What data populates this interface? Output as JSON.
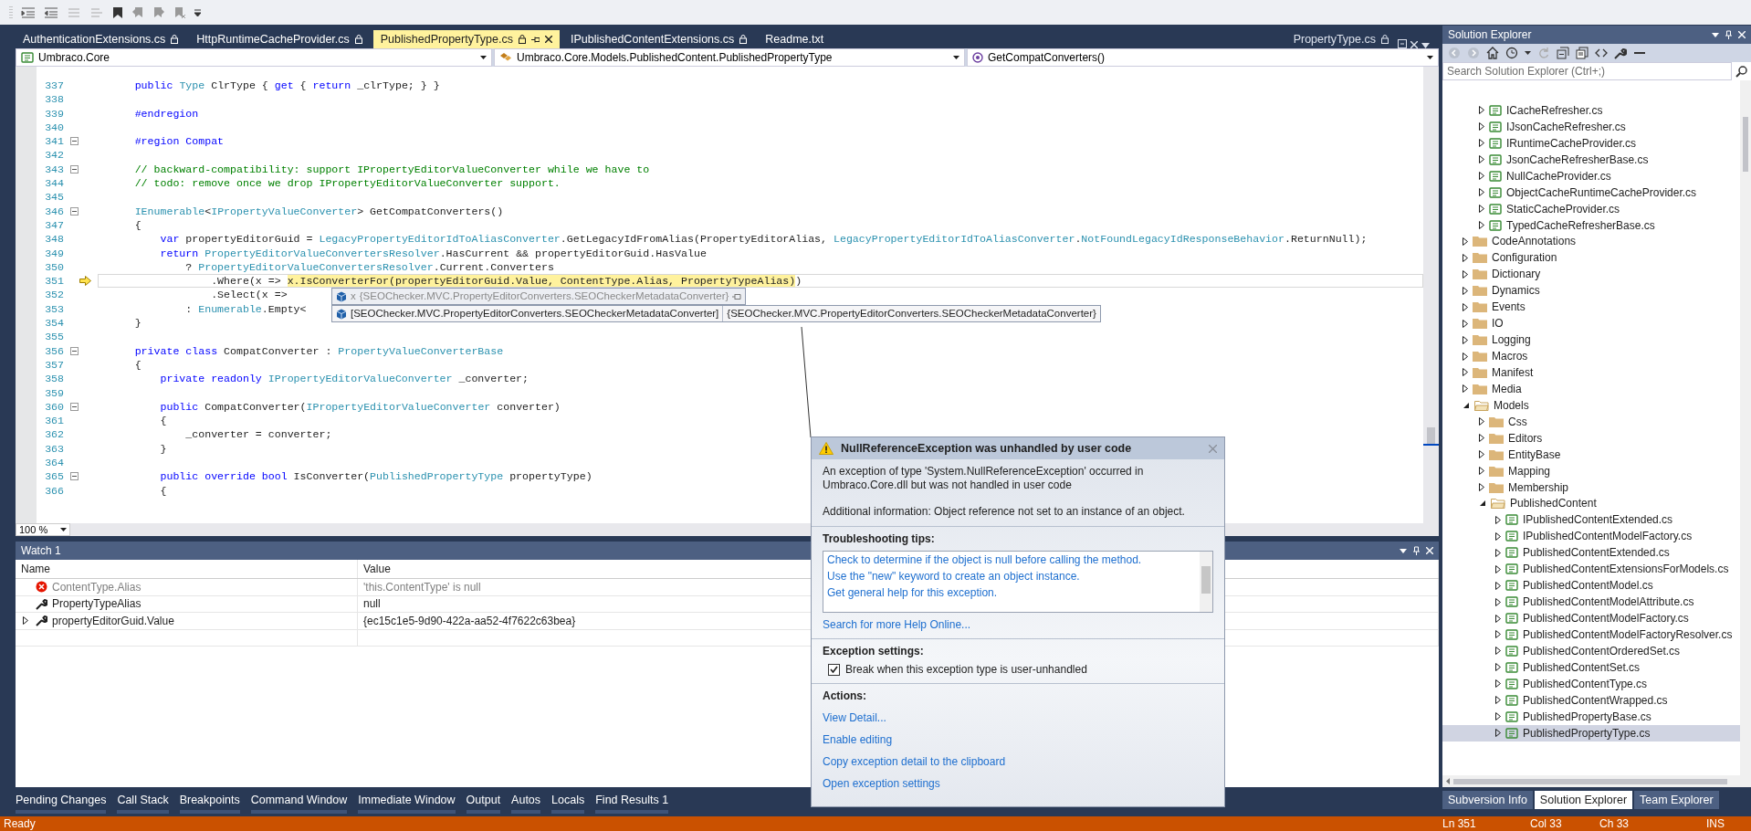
{
  "document_tabs": [
    {
      "label": "AuthenticationExtensions.cs",
      "selected": false,
      "locked": true
    },
    {
      "label": "HttpRuntimeCacheProvider.cs",
      "selected": false,
      "locked": true
    },
    {
      "label": "PublishedPropertyType.cs",
      "selected": true,
      "locked": true
    },
    {
      "label": "IPublishedContentExtensions.cs",
      "selected": false,
      "locked": true
    },
    {
      "label": "Readme.txt",
      "selected": false,
      "locked": false
    }
  ],
  "preview_tab": {
    "label": "PropertyType.cs",
    "locked": true
  },
  "navigation_bar": {
    "project": "Umbraco.Core",
    "type": "Umbraco.Core.Models.PublishedContent.PublishedPropertyType",
    "member": "GetCompatConverters()"
  },
  "editor": {
    "lines": [
      {
        "number": "337",
        "fold": false,
        "current": false,
        "tokens": [
          {
            "kind": "keyword",
            "text": "        public "
          },
          {
            "kind": "type",
            "text": "Type"
          },
          {
            "kind": "plain",
            "text": " ClrType { "
          },
          {
            "kind": "keyword",
            "text": "get"
          },
          {
            "kind": "plain",
            "text": " { "
          },
          {
            "kind": "keyword",
            "text": "return"
          },
          {
            "kind": "plain",
            "text": " _clrType; } }"
          }
        ]
      },
      {
        "number": "338",
        "fold": false,
        "current": false
      },
      {
        "number": "339",
        "fold": false,
        "current": false,
        "tokens": [
          {
            "kind": "directive",
            "text": "        #endregion"
          }
        ]
      },
      {
        "number": "340",
        "fold": false,
        "current": false
      },
      {
        "number": "341",
        "fold": true,
        "current": false,
        "tokens": [
          {
            "kind": "directive",
            "text": "        #region Compat"
          }
        ]
      },
      {
        "number": "342",
        "fold": false,
        "current": false
      },
      {
        "number": "343",
        "fold": true,
        "current": false,
        "tokens": [
          {
            "kind": "comment",
            "text": "        // backward-compatibility: support IPropertyEditorValueConverter while we have to"
          }
        ]
      },
      {
        "number": "344",
        "fold": false,
        "current": false,
        "tokens": [
          {
            "kind": "comment",
            "text": "        // todo: remove once we drop IPropertyEditorValueConverter support."
          }
        ]
      },
      {
        "number": "345",
        "fold": false,
        "current": false
      },
      {
        "number": "346",
        "fold": true,
        "current": false,
        "tokens": [
          {
            "kind": "type",
            "text": "        IEnumerable"
          },
          {
            "kind": "plain",
            "text": "<"
          },
          {
            "kind": "type",
            "text": "IPropertyValueConverter"
          },
          {
            "kind": "plain",
            "text": "> GetCompatConverters()"
          }
        ]
      },
      {
        "number": "347",
        "fold": false,
        "current": false,
        "tokens": [
          {
            "kind": "plain",
            "text": "        {"
          }
        ]
      },
      {
        "number": "348",
        "fold": false,
        "current": false,
        "tokens": [
          {
            "kind": "keyword",
            "text": "            var"
          },
          {
            "kind": "plain",
            "text": " propertyEditorGuid = "
          },
          {
            "kind": "type",
            "text": "LegacyPropertyEditorIdToAliasConverter"
          },
          {
            "kind": "plain",
            "text": ".GetLegacyIdFromAlias(PropertyEditorAlias, "
          },
          {
            "kind": "type",
            "text": "LegacyPropertyEditorIdToAliasConverter"
          },
          {
            "kind": "plain",
            "text": "."
          },
          {
            "kind": "type",
            "text": "NotFoundLegacyIdResponseBehavior"
          },
          {
            "kind": "plain",
            "text": ".ReturnNull);"
          }
        ]
      },
      {
        "number": "349",
        "fold": false,
        "current": false,
        "tokens": [
          {
            "kind": "keyword",
            "text": "            return "
          },
          {
            "kind": "type",
            "text": "PropertyEditorValueConvertersResolver"
          },
          {
            "kind": "plain",
            "text": ".HasCurrent && propertyEditorGuid.HasValue"
          }
        ]
      },
      {
        "number": "350",
        "fold": false,
        "current": false,
        "tokens": [
          {
            "kind": "plain",
            "text": "                ? "
          },
          {
            "kind": "type",
            "text": "PropertyEditorValueConvertersResolver"
          },
          {
            "kind": "plain",
            "text": ".Current.Converters"
          }
        ]
      },
      {
        "number": "351",
        "fold": false,
        "current": true,
        "tokens": [
          {
            "kind": "plain",
            "text": "                    .Where(x => "
          },
          {
            "kind": "statement",
            "text": "x.IsConverterFor(propertyEditorGuid.Value, ContentType.Alias, PropertyTypeAlias)"
          },
          {
            "kind": "plain",
            "text": ")"
          }
        ]
      },
      {
        "number": "352",
        "fold": false,
        "current": false,
        "tokens": [
          {
            "kind": "plain",
            "text": "                    .Select(x => "
          }
        ]
      },
      {
        "number": "353",
        "fold": false,
        "current": false,
        "tokens": [
          {
            "kind": "plain",
            "text": "                : "
          },
          {
            "kind": "type",
            "text": "Enumerable"
          },
          {
            "kind": "plain",
            "text": ".Empty<"
          }
        ]
      },
      {
        "number": "354",
        "fold": false,
        "current": false,
        "tokens": [
          {
            "kind": "plain",
            "text": "        }"
          }
        ]
      },
      {
        "number": "355",
        "fold": false,
        "current": false
      },
      {
        "number": "356",
        "fold": true,
        "current": false,
        "tokens": [
          {
            "kind": "keyword",
            "text": "        private class "
          },
          {
            "kind": "plain",
            "text": "CompatConverter : "
          },
          {
            "kind": "type",
            "text": "PropertyValueConverterBase"
          }
        ]
      },
      {
        "number": "357",
        "fold": false,
        "current": false,
        "tokens": [
          {
            "kind": "plain",
            "text": "        {"
          }
        ]
      },
      {
        "number": "358",
        "fold": false,
        "current": false,
        "tokens": [
          {
            "kind": "keyword",
            "text": "            private readonly "
          },
          {
            "kind": "type",
            "text": "IPropertyEditorValueConverter"
          },
          {
            "kind": "plain",
            "text": " _converter;"
          }
        ]
      },
      {
        "number": "359",
        "fold": false,
        "current": false
      },
      {
        "number": "360",
        "fold": true,
        "current": false,
        "tokens": [
          {
            "kind": "keyword",
            "text": "            public "
          },
          {
            "kind": "plain",
            "text": "CompatConverter("
          },
          {
            "kind": "type",
            "text": "IPropertyEditorValueConverter"
          },
          {
            "kind": "plain",
            "text": " converter)"
          }
        ]
      },
      {
        "number": "361",
        "fold": false,
        "current": false,
        "tokens": [
          {
            "kind": "plain",
            "text": "            {"
          }
        ]
      },
      {
        "number": "362",
        "fold": false,
        "current": false,
        "tokens": [
          {
            "kind": "plain",
            "text": "                _converter = converter;"
          }
        ]
      },
      {
        "number": "363",
        "fold": false,
        "current": false,
        "tokens": [
          {
            "kind": "plain",
            "text": "            }"
          }
        ]
      },
      {
        "number": "364",
        "fold": false,
        "current": false
      },
      {
        "number": "365",
        "fold": true,
        "current": false,
        "tokens": [
          {
            "kind": "keyword",
            "text": "            public override bool "
          },
          {
            "kind": "plain",
            "text": "IsConverter("
          },
          {
            "kind": "type",
            "text": "PublishedPropertyType"
          },
          {
            "kind": "plain",
            "text": " propertyType)"
          }
        ]
      },
      {
        "number": "366",
        "fold": false,
        "current": false,
        "tokens": [
          {
            "kind": "plain",
            "text": "            {"
          }
        ]
      }
    ],
    "data_tip": {
      "rows": [
        {
          "kind": "parent",
          "name": "x",
          "value": "{SEOChecker.MVC.PropertyEditorConverters.SEOCheckerMetadataConverter}"
        },
        {
          "kind": "member",
          "name": "[SEOChecker.MVC.PropertyEditorConverters.SEOCheckerMetadataConverter]",
          "value": "{SEOChecker.MVC.PropertyEditorConverters.SEOCheckerMetadataConverter}"
        }
      ]
    },
    "zoom": "100 %"
  },
  "exception_helper": {
    "title": "NullReferenceException was unhandled by user code",
    "message": "An exception of type 'System.NullReferenceException' occurred in Umbraco.Core.dll but was not handled in user code",
    "additional_info": "Additional information: Object reference not set to an instance of an object.",
    "tips_heading": "Troubleshooting tips:",
    "tips": [
      "Check to determine if the object is null before calling the method.",
      "Use the \"new\" keyword to create an object instance.",
      "Get general help for this exception."
    ],
    "help_link": "Search for more Help Online...",
    "settings_heading": "Exception settings:",
    "break_option": {
      "label": "Break when this exception type is user-unhandled",
      "checked": true
    },
    "actions_heading": "Actions:",
    "actions": [
      "View Detail...",
      "Enable editing",
      "Copy exception detail to the clipboard",
      "Open exception settings"
    ]
  },
  "watch": {
    "title": "Watch 1",
    "columns": [
      "Name",
      "Value"
    ],
    "rows": [
      {
        "kind": "error",
        "name": "ContentType.Alias",
        "value": "'this.ContentType' is null",
        "expandable": false
      },
      {
        "kind": "property",
        "name": "PropertyTypeAlias",
        "value": "null",
        "expandable": false
      },
      {
        "kind": "property",
        "name": "propertyEditorGuid.Value",
        "value": "{ec15c1e5-9d90-422a-aa52-4f7622c63bea}",
        "expandable": true
      }
    ]
  },
  "tool_tabs": [
    "Pending Changes",
    "Call Stack",
    "Breakpoints",
    "Command Window",
    "Immediate Window",
    "Output",
    "Autos",
    "Locals",
    "Find Results 1"
  ],
  "solution_explorer": {
    "title": "Solution Explorer",
    "search": {
      "placeholder": "Search Solution Explorer (Ctrl+;)"
    },
    "tree": [
      {
        "kind": "offscreen",
        "children": [
          {
            "kind": "file",
            "label": "ICacheRefresher.cs",
            "expanded": false,
            "selected": false
          },
          {
            "kind": "file",
            "label": "IJsonCacheRefresher.cs",
            "expanded": false,
            "selected": false
          },
          {
            "kind": "file",
            "label": "IRuntimeCacheProvider.cs",
            "expanded": false,
            "selected": false
          },
          {
            "kind": "file",
            "label": "JsonCacheRefresherBase.cs",
            "expanded": false,
            "selected": false
          },
          {
            "kind": "file",
            "label": "NullCacheProvider.cs",
            "expanded": false,
            "selected": false
          },
          {
            "kind": "file",
            "label": "ObjectCacheRuntimeCacheProvider.cs",
            "expanded": false,
            "selected": false
          },
          {
            "kind": "file",
            "label": "StaticCacheProvider.cs",
            "expanded": false,
            "selected": false
          },
          {
            "kind": "file",
            "label": "TypedCacheRefresherBase.cs",
            "expanded": false,
            "selected": false
          }
        ]
      },
      {
        "kind": "folder",
        "label": "CodeAnnotations",
        "expanded": false,
        "selected": false
      },
      {
        "kind": "folder",
        "label": "Configuration",
        "expanded": false,
        "selected": false
      },
      {
        "kind": "folder",
        "label": "Dictionary",
        "expanded": false,
        "selected": false
      },
      {
        "kind": "folder",
        "label": "Dynamics",
        "expanded": false,
        "selected": false
      },
      {
        "kind": "folder",
        "label": "Events",
        "expanded": false,
        "selected": false
      },
      {
        "kind": "folder",
        "label": "IO",
        "expanded": false,
        "selected": false
      },
      {
        "kind": "folder",
        "label": "Logging",
        "expanded": false,
        "selected": false
      },
      {
        "kind": "folder",
        "label": "Macros",
        "expanded": false,
        "selected": false
      },
      {
        "kind": "folder",
        "label": "Manifest",
        "expanded": false,
        "selected": false
      },
      {
        "kind": "folder",
        "label": "Media",
        "expanded": false,
        "selected": false
      },
      {
        "kind": "folder",
        "label": "Models",
        "expanded": true,
        "selected": false,
        "children": [
          {
            "kind": "folder",
            "label": "Css",
            "expanded": false,
            "selected": false
          },
          {
            "kind": "folder",
            "label": "Editors",
            "expanded": false,
            "selected": false
          },
          {
            "kind": "folder",
            "label": "EntityBase",
            "expanded": false,
            "selected": false
          },
          {
            "kind": "folder",
            "label": "Mapping",
            "expanded": false,
            "selected": false
          },
          {
            "kind": "folder",
            "label": "Membership",
            "expanded": false,
            "selected": false
          },
          {
            "kind": "folder",
            "label": "PublishedContent",
            "expanded": true,
            "selected": false,
            "children": [
              {
                "kind": "file",
                "label": "IPublishedContentExtended.cs",
                "expanded": false,
                "selected": false
              },
              {
                "kind": "file",
                "label": "IPublishedContentModelFactory.cs",
                "expanded": false,
                "selected": false
              },
              {
                "kind": "file",
                "label": "PublishedContentExtended.cs",
                "expanded": false,
                "selected": false
              },
              {
                "kind": "file",
                "label": "PublishedContentExtensionsForModels.cs",
                "expanded": false,
                "selected": false
              },
              {
                "kind": "file",
                "label": "PublishedContentModel.cs",
                "expanded": false,
                "selected": false
              },
              {
                "kind": "file",
                "label": "PublishedContentModelAttribute.cs",
                "expanded": false,
                "selected": false
              },
              {
                "kind": "file",
                "label": "PublishedContentModelFactory.cs",
                "expanded": false,
                "selected": false
              },
              {
                "kind": "file",
                "label": "PublishedContentModelFactoryResolver.cs",
                "expanded": false,
                "selected": false
              },
              {
                "kind": "file",
                "label": "PublishedContentOrderedSet.cs",
                "expanded": false,
                "selected": false
              },
              {
                "kind": "file",
                "label": "PublishedContentSet.cs",
                "expanded": false,
                "selected": false
              },
              {
                "kind": "file",
                "label": "PublishedContentType.cs",
                "expanded": false,
                "selected": false
              },
              {
                "kind": "file",
                "label": "PublishedContentWrapped.cs",
                "expanded": false,
                "selected": false
              },
              {
                "kind": "file",
                "label": "PublishedPropertyBase.cs",
                "expanded": false,
                "selected": false
              },
              {
                "kind": "file",
                "label": "PublishedPropertyType.cs",
                "expanded": false,
                "selected": true
              }
            ]
          }
        ]
      }
    ],
    "tabs": [
      {
        "label": "Subversion Info",
        "selected": false
      },
      {
        "label": "Solution Explorer",
        "selected": true
      },
      {
        "label": "Team Explorer",
        "selected": false
      }
    ]
  },
  "status_bar": {
    "message": "Ready",
    "line": "Ln 351",
    "column": "Col 33",
    "char": "Ch 33",
    "mode": "INS"
  }
}
